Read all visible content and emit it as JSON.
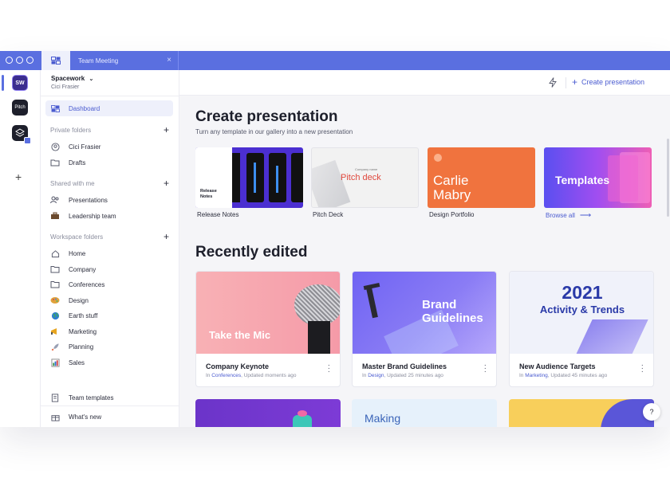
{
  "tabbar": {
    "tab_title": "Team Meeting"
  },
  "rail": {
    "workspaces": [
      {
        "name": "Spacework",
        "short": "SW",
        "color": "#3b2d8f"
      },
      {
        "name": "Pitch",
        "short": "Pitch",
        "color": "#1d1f2b"
      },
      {
        "name": "Layers",
        "short": "",
        "color": "#1d1f2b"
      }
    ]
  },
  "sidebar": {
    "workspace_name": "Spacework",
    "user_name": "Cici Frasier",
    "dashboard_label": "Dashboard",
    "private": {
      "title": "Private folders",
      "items": [
        {
          "label": "Cici Frasier",
          "icon": "user-circle-icon"
        },
        {
          "label": "Drafts",
          "icon": "draft-folder-icon"
        }
      ]
    },
    "shared": {
      "title": "Shared with me",
      "items": [
        {
          "label": "Presentations",
          "icon": "people-icon"
        },
        {
          "label": "Leadership team",
          "icon": "briefcase-icon"
        }
      ]
    },
    "workspace": {
      "title": "Workspace folders",
      "items": [
        {
          "label": "Home",
          "icon": "home-icon"
        },
        {
          "label": "Company",
          "icon": "folder-icon"
        },
        {
          "label": "Conferences",
          "icon": "folder-icon"
        },
        {
          "label": "Design",
          "icon": "palette-icon"
        },
        {
          "label": "Earth stuff",
          "icon": "globe-icon"
        },
        {
          "label": "Marketing",
          "icon": "megaphone-icon"
        },
        {
          "label": "Planning",
          "icon": "rocket-icon"
        },
        {
          "label": "Sales",
          "icon": "chart-icon"
        }
      ]
    },
    "bottom": [
      {
        "label": "Team templates",
        "icon": "template-icon"
      },
      {
        "label": "What's new",
        "icon": "gift-icon"
      }
    ]
  },
  "header": {
    "create_label": "Create presentation"
  },
  "main": {
    "create_title": "Create presentation",
    "create_subtitle": "Turn any template in our gallery into a new presentation",
    "templates": [
      {
        "label": "Release Notes",
        "thumb_text": "Release Notes"
      },
      {
        "label": "Pitch Deck",
        "thumb_text": "Pitch deck",
        "thumb_small": "Company name"
      },
      {
        "label": "Design Portfolio",
        "thumb_text": "Carlie Mabry"
      },
      {
        "label": "",
        "thumb_text": "Templates"
      }
    ],
    "browse_label": "Browse all",
    "recent_title": "Recently edited",
    "cards": [
      {
        "title": "Company Keynote",
        "folder": "Conferences",
        "updated": "Updated moments ago",
        "thumb_text": "Take the Mic"
      },
      {
        "title": "Master Brand Guidelines",
        "folder": "Design",
        "updated": "Updated 25 minutes ago",
        "thumb_text": "Brand Guidelines"
      },
      {
        "title": "New Audience Targets",
        "folder": "Marketing",
        "updated": "Updated 45 minutes ago",
        "thumb_year": "2021",
        "thumb_text": "Activity & Trends"
      }
    ],
    "in_label": "In",
    "more_row": [
      {
        "thumb_text": ""
      },
      {
        "thumb_text": "Making"
      },
      {
        "thumb_text": ""
      }
    ]
  },
  "help_label": "?"
}
